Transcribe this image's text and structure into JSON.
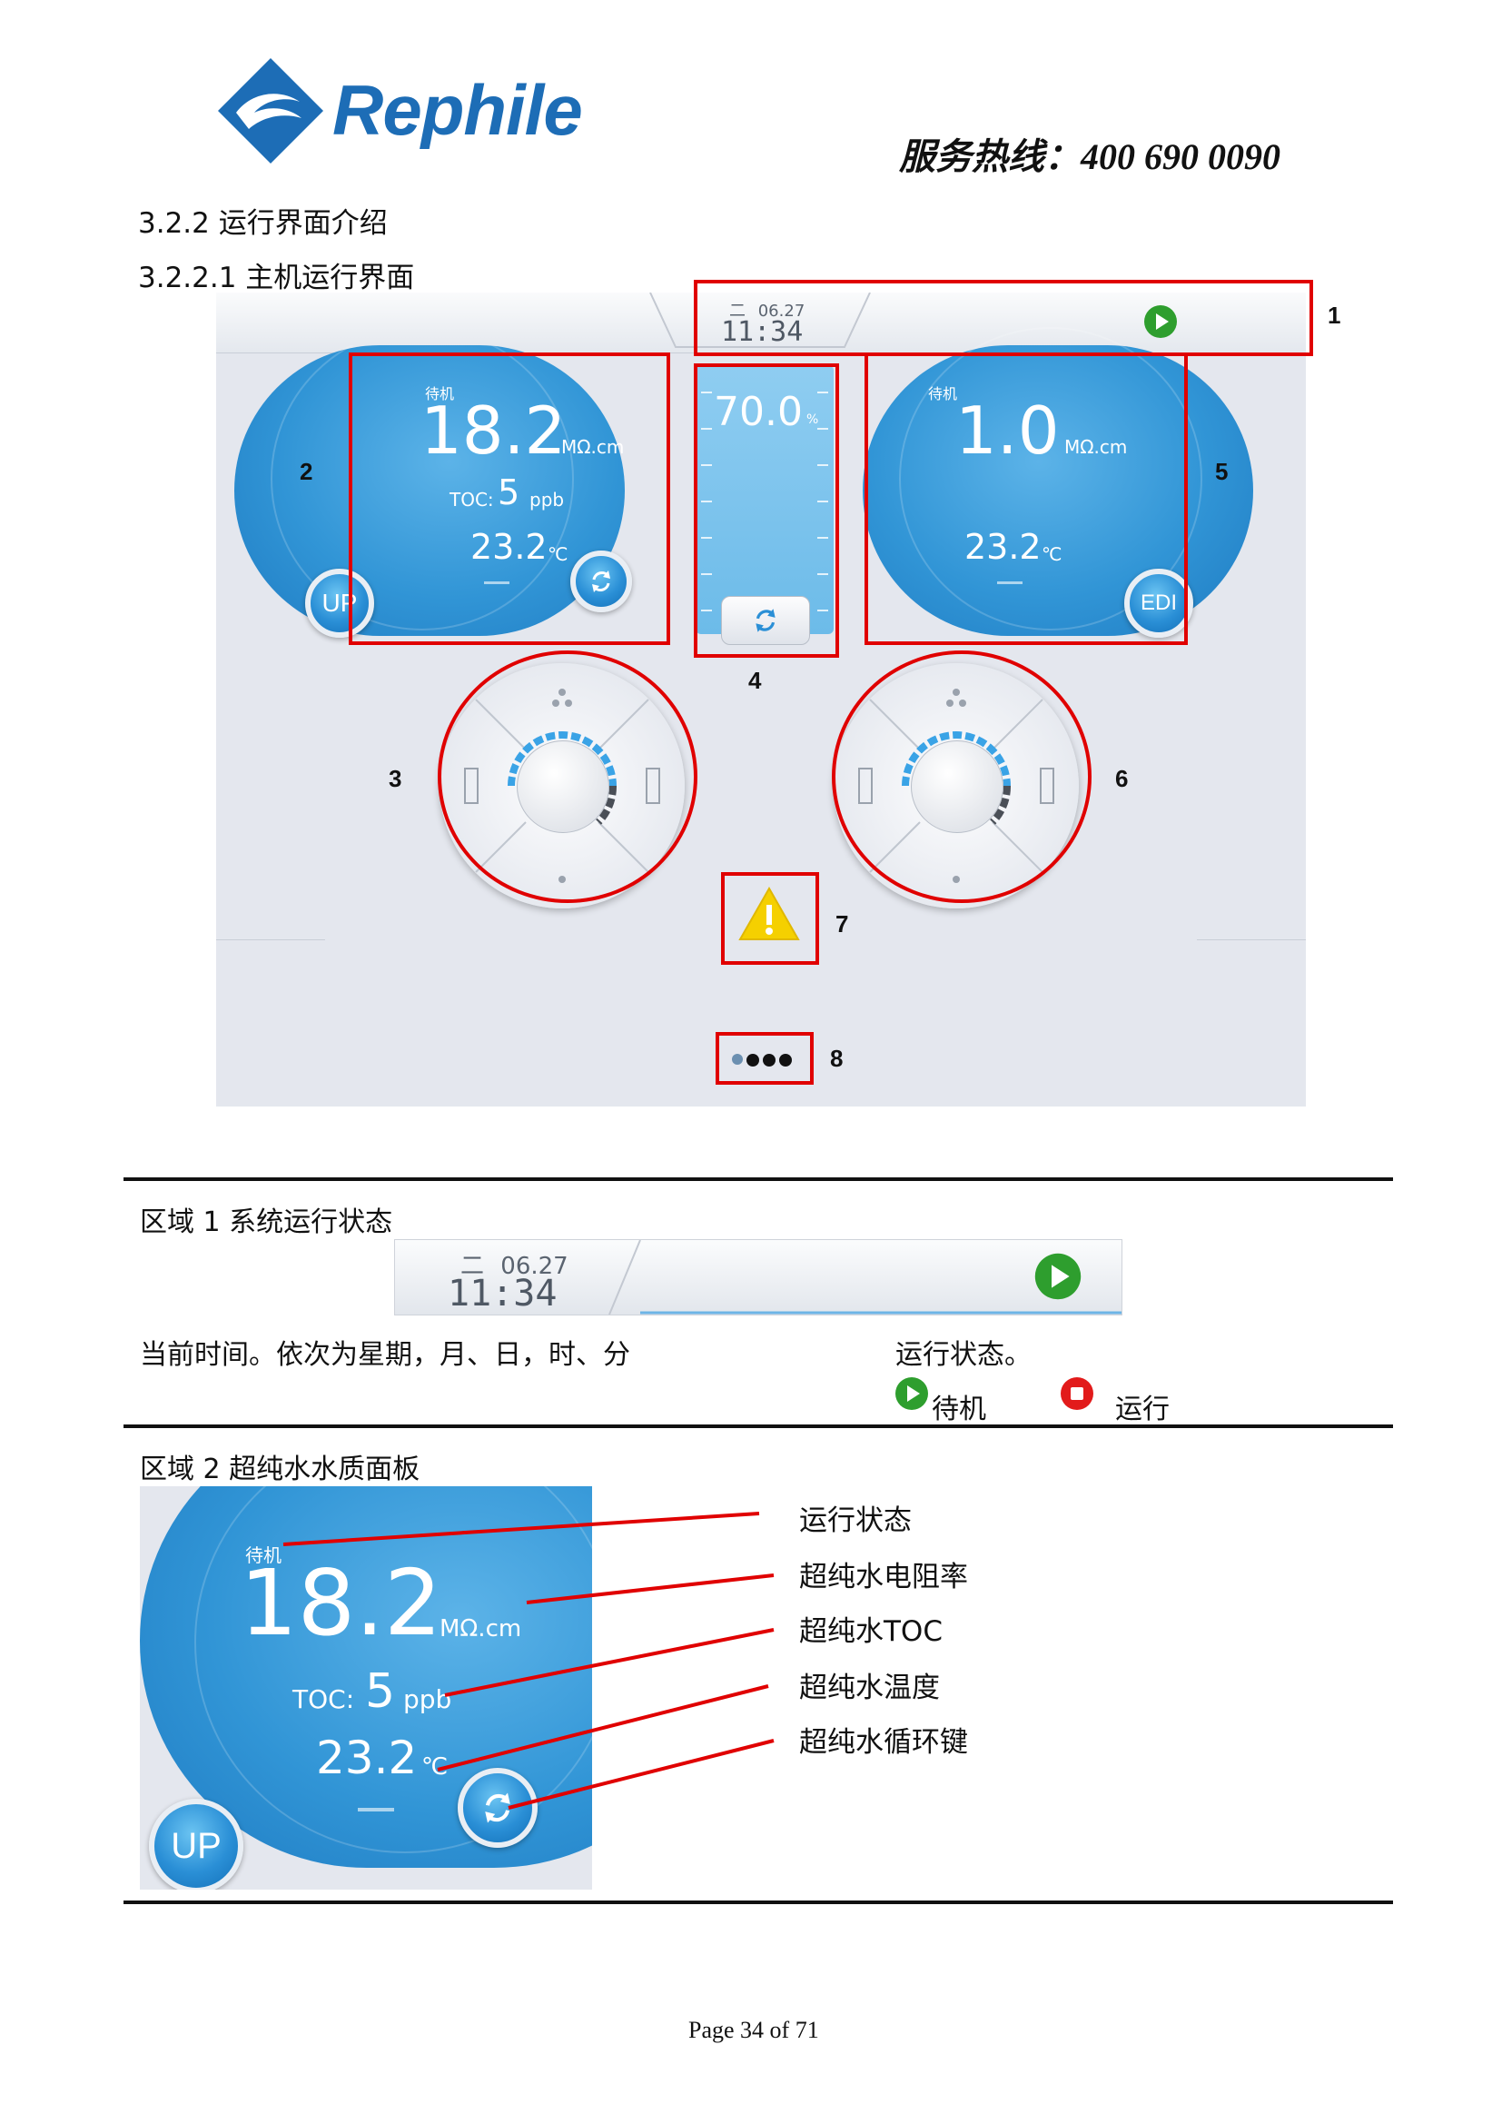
{
  "header": {
    "brand": "Rephile",
    "hotline": "服务热线：400  690  0090"
  },
  "headings": {
    "h1": "3.2.2 运行界面介绍",
    "h2": "3.2.2.1  主机运行界面"
  },
  "screen": {
    "weekday": "二",
    "date": "06.27",
    "time": "11:34",
    "left_panel": {
      "status": "待机",
      "resistivity": "18.2",
      "res_unit": "MΩ.cm",
      "toc_label": "TOC:",
      "toc_value": "5",
      "toc_unit": "ppb",
      "temp": "23.2",
      "temp_unit": "℃",
      "badge": "UP"
    },
    "tank": {
      "level": "70.0",
      "unit": "%",
      "level_percent": 70
    },
    "right_panel": {
      "status": "待机",
      "resistivity": "1.0",
      "res_unit": "MΩ.cm",
      "temp": "23.2",
      "temp_unit": "℃",
      "badge": "EDI"
    },
    "region_labels": [
      "1",
      "2",
      "3",
      "4",
      "5",
      "6",
      "7",
      "8"
    ]
  },
  "zone1": {
    "title": "区域  1    系统运行状态",
    "weekday": "二",
    "date": "06.27",
    "time": "11:34",
    "desc_time": "当前时间。依次为星期，月、日，时、分",
    "desc_state": "运行状态。",
    "standby_label": "待机",
    "running_label": "运行"
  },
  "zone2": {
    "title": "区域  2    超纯水水质面板",
    "panel": {
      "status": "待机",
      "resistivity": "18.2",
      "res_unit": "MΩ.cm",
      "toc_label": "TOC:",
      "toc_value": "5",
      "toc_unit": "ppb",
      "temp": "23.2",
      "temp_unit": "℃",
      "badge": "UP"
    },
    "callouts": [
      "运行状态",
      "超纯水电阻率",
      "超纯水TOC",
      "超纯水温度",
      "超纯水循环键"
    ]
  },
  "footer": {
    "page": "Page 34 of 71"
  },
  "colors": {
    "accent_blue": "#2f8fd2",
    "highlight_red": "#e00000",
    "play_green": "#2e9e2e",
    "stop_red": "#e21b1b",
    "warning_yellow": "#f5d000"
  }
}
